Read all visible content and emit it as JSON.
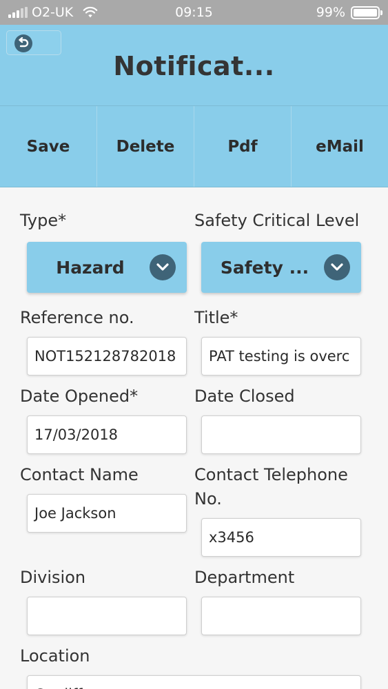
{
  "status_bar": {
    "carrier": "O2-UK",
    "time": "09:15",
    "battery": "99%",
    "battery_level": 0.99
  },
  "header": {
    "title": "Notificat...",
    "back_icon": "undo-arrow-icon"
  },
  "toolbar": {
    "save_label": "Save",
    "delete_label": "Delete",
    "pdf_label": "Pdf",
    "email_label": "eMail"
  },
  "form": {
    "type": {
      "label": "Type*",
      "value": "Hazard"
    },
    "safety_level": {
      "label": "Safety Critical Level",
      "value": "Safety ..."
    },
    "reference": {
      "label": "Reference no.",
      "value": "NOT152128782018"
    },
    "title": {
      "label": "Title*",
      "value": "PAT testing is overc"
    },
    "date_opened": {
      "label": "Date Opened*",
      "value": "17/03/2018"
    },
    "date_closed": {
      "label": "Date Closed",
      "value": ""
    },
    "contact_name": {
      "label": "Contact Name",
      "value": "Joe Jackson"
    },
    "contact_phone": {
      "label_line1": "Contact Telephone",
      "label_line2": "No.",
      "value": "x3456"
    },
    "division": {
      "label": "Division",
      "value": ""
    },
    "department": {
      "label": "Department",
      "value": ""
    },
    "location": {
      "label": "Location",
      "value": "Cardiff"
    }
  }
}
